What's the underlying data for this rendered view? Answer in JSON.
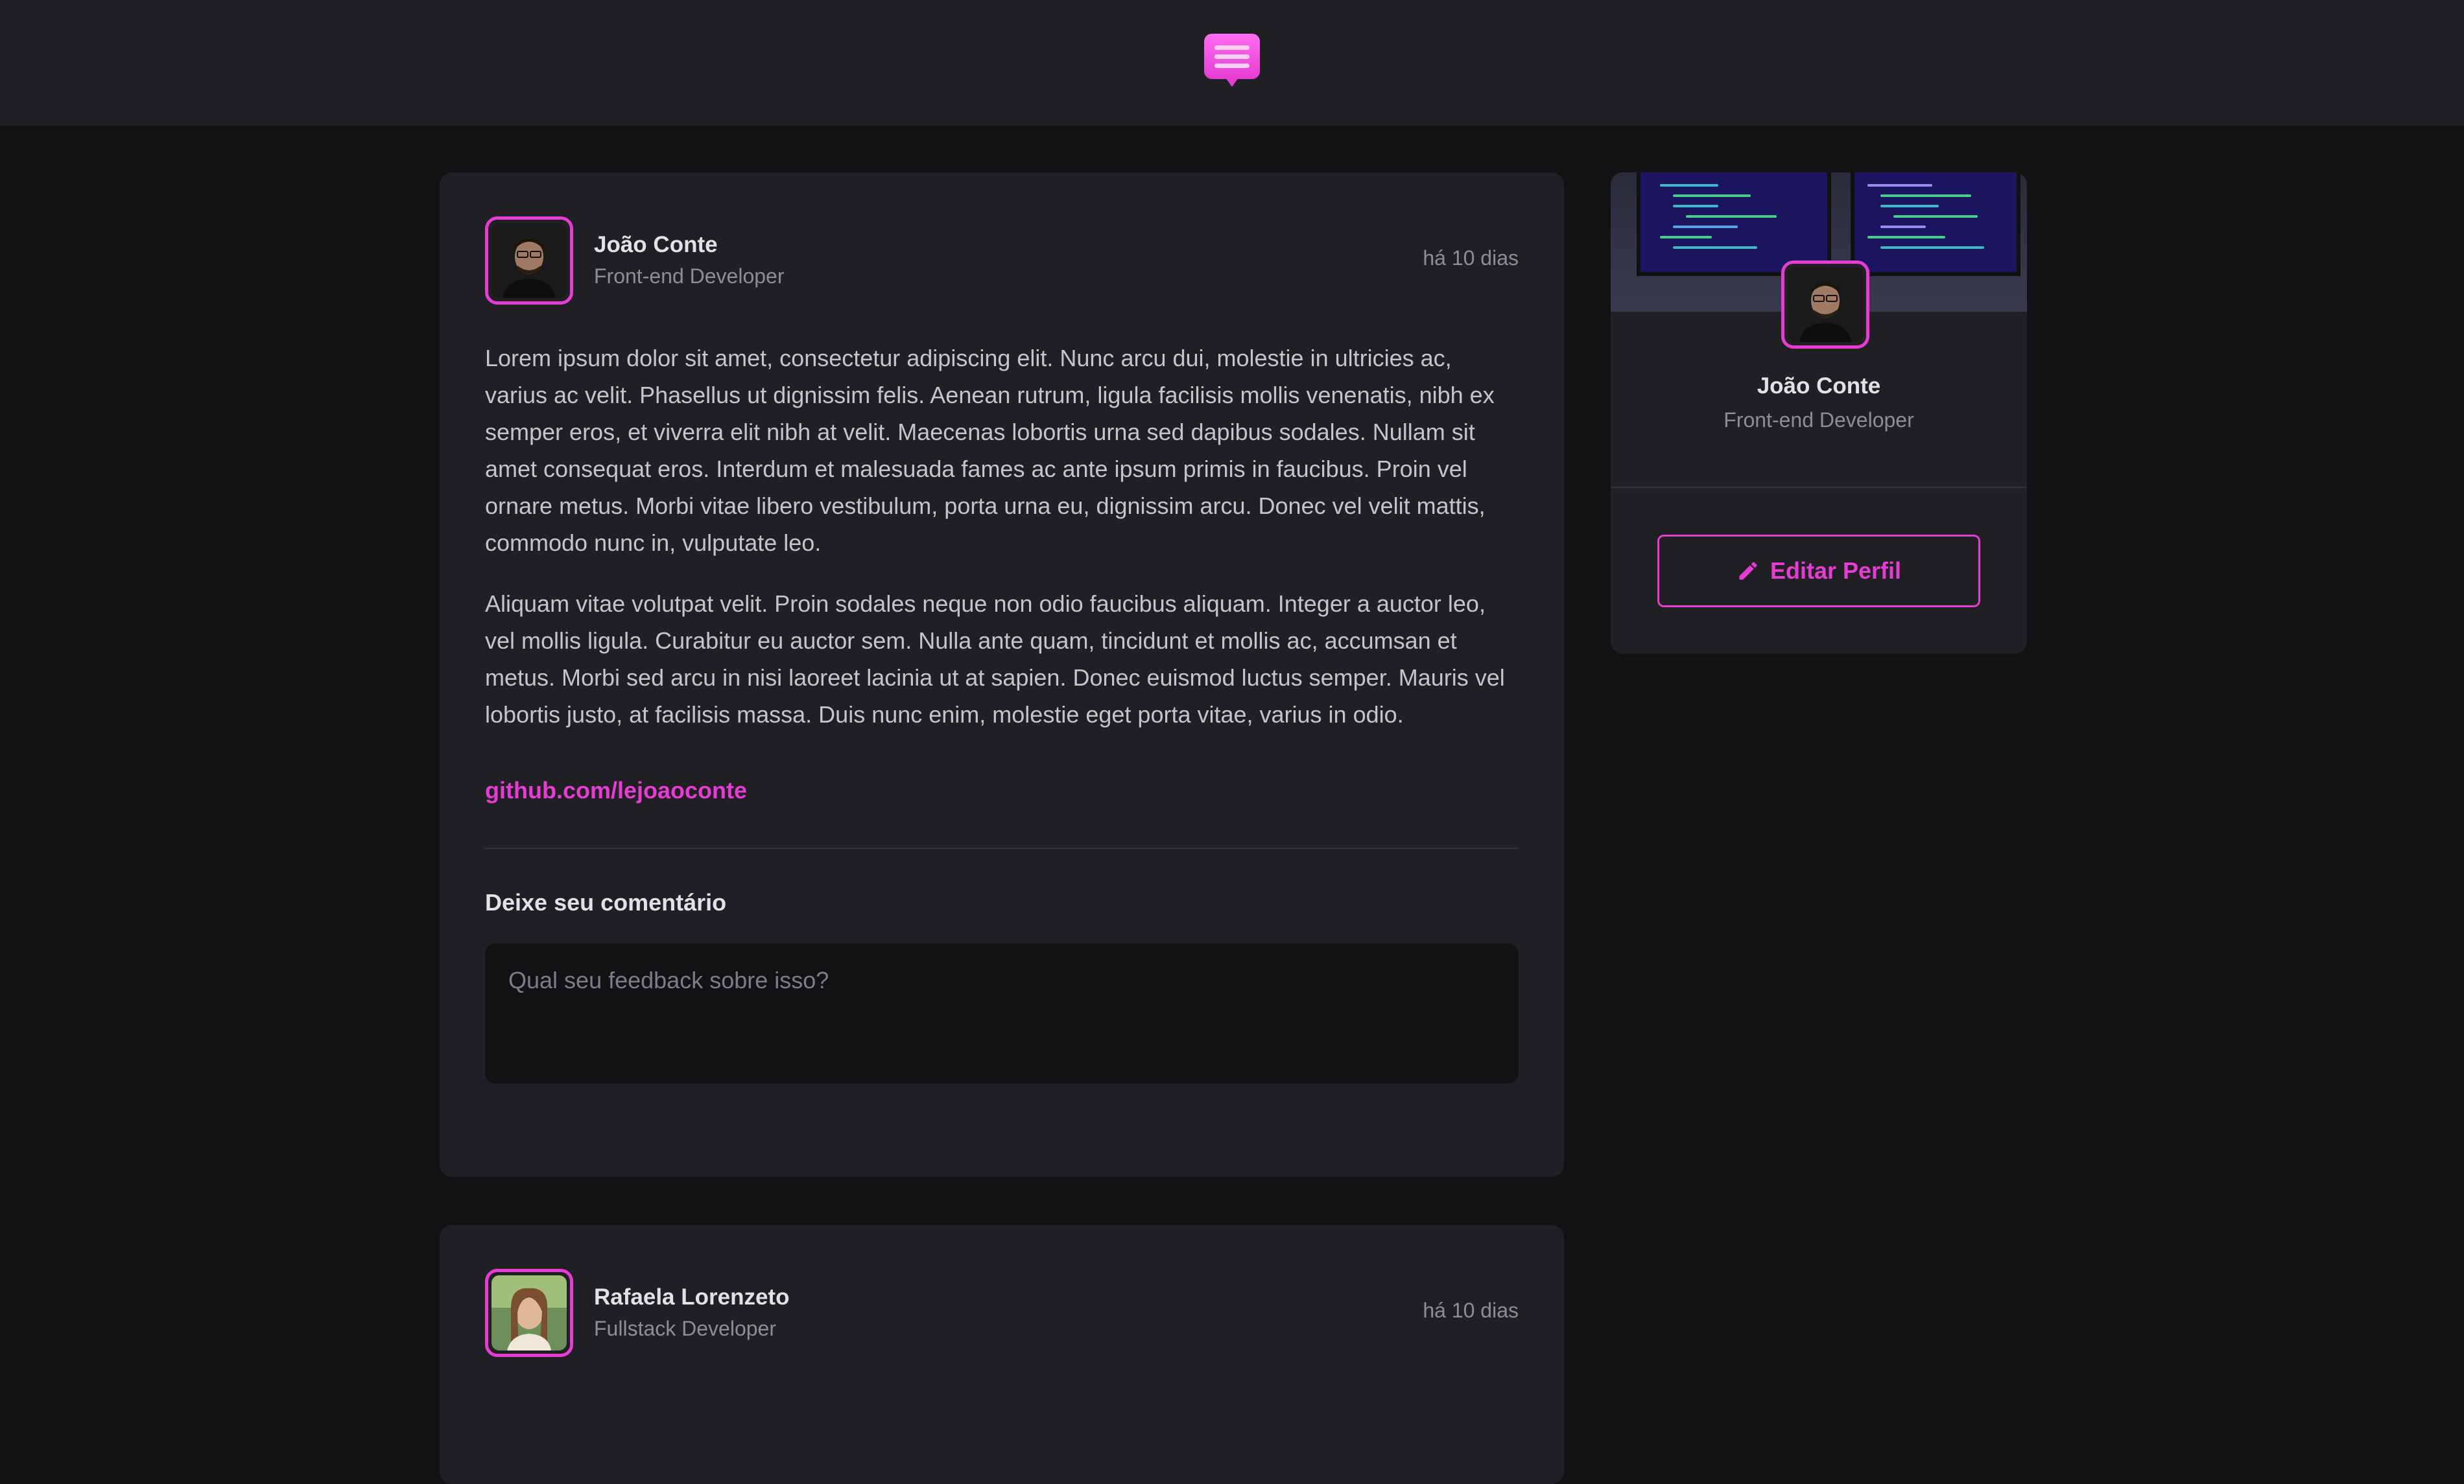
{
  "colors": {
    "accent": "#e73cd4",
    "background": "#121214",
    "surface": "#202024"
  },
  "header": {
    "logo_icon": "chat-bubble-icon"
  },
  "posts": [
    {
      "author_name": "João Conte",
      "author_role": "Front-end Developer",
      "time": "há 10 dias",
      "paragraphs": [
        "Lorem ipsum dolor sit amet, consectetur adipiscing elit. Nunc arcu dui, molestie in ultricies ac, varius ac velit. Phasellus ut dignissim felis. Aenean rutrum, ligula facilisis mollis venenatis, nibh ex semper eros, et viverra elit nibh at velit. Maecenas lobortis urna sed dapibus sodales. Nullam sit amet consequat eros. Interdum et malesuada fames ac ante ipsum primis in faucibus. Proin vel ornare metus. Morbi vitae libero vestibulum, porta urna eu, dignissim arcu. Donec vel velit mattis, commodo nunc in, vulputate leo.",
        "Aliquam vitae volutpat velit. Proin sodales neque non odio faucibus aliquam. Integer a auctor leo, vel mollis ligula. Curabitur eu auctor sem. Nulla ante quam, tincidunt et mollis ac, accumsan et metus. Morbi sed arcu in nisi laoreet lacinia ut at sapien. Donec euismod luctus semper. Mauris vel lobortis justo, at facilisis massa. Duis nunc enim, molestie eget porta vitae, varius in odio."
      ],
      "link": "github.com/lejoaoconte",
      "comment_title": "Deixe seu comentário",
      "comment_placeholder": "Qual seu feedback sobre isso?"
    },
    {
      "author_name": "Rafaela Lorenzeto",
      "author_role": "Fullstack Developer",
      "time": "há 10 dias"
    }
  ],
  "sidebar": {
    "name": "João Conte",
    "role": "Front-end Developer",
    "edit_button_label": "Editar Perfil",
    "edit_icon": "pencil-icon"
  }
}
